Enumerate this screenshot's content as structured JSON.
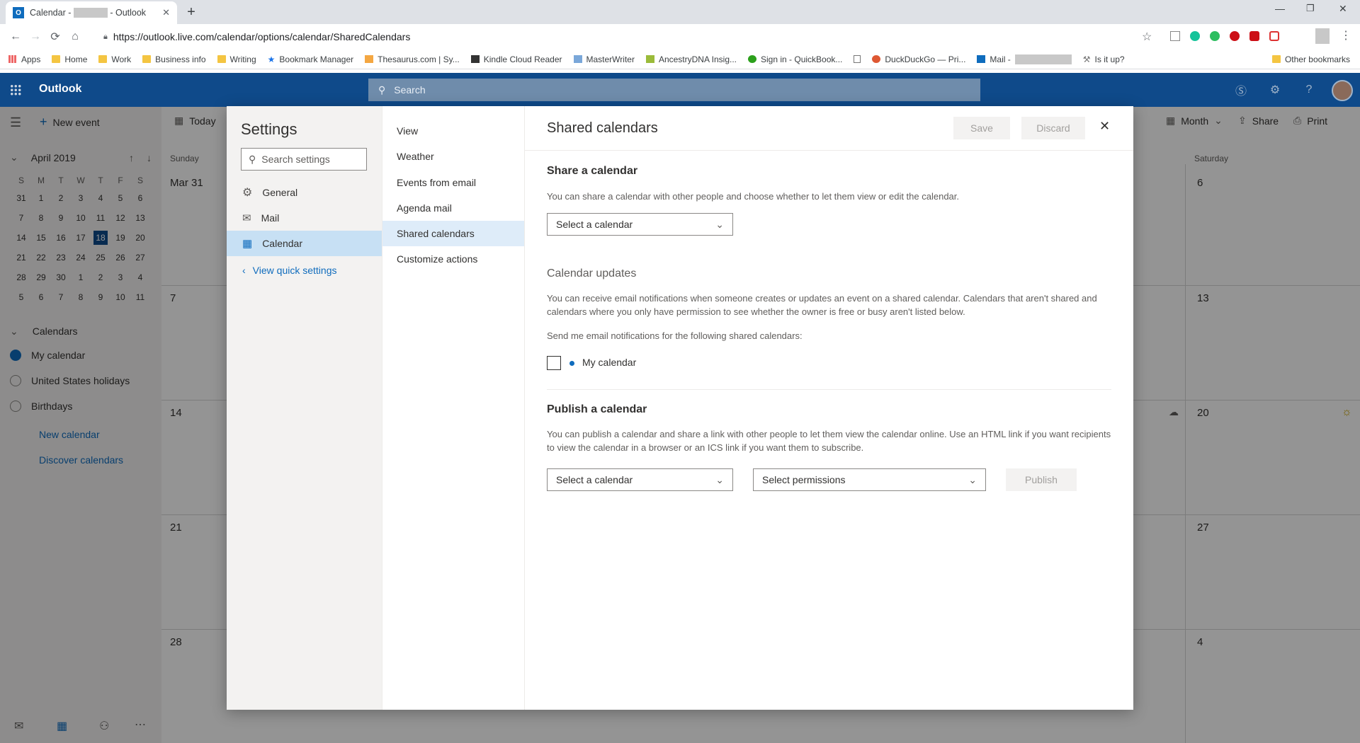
{
  "browser": {
    "tab_title_prefix": "Calendar -",
    "tab_title_suffix": "- Outlook",
    "url": "https://outlook.live.com/calendar/options/calendar/SharedCalendars",
    "bookmarks": [
      "Apps",
      "Home",
      "Work",
      "Business info",
      "Writing",
      "Bookmark Manager",
      "Thesaurus.com | Sy...",
      "Kindle Cloud Reader",
      "MasterWriter",
      "AncestryDNA Insig...",
      "Sign in - QuickBook...",
      "DuckDuckGo — Pri...",
      "Mail -",
      "Is it up?"
    ],
    "other_bookmarks": "Other bookmarks"
  },
  "header": {
    "brand": "Outlook",
    "search_placeholder": "Search"
  },
  "app": {
    "new_event": "New event",
    "today": "Today",
    "view_mode": "Month",
    "share": "Share",
    "print": "Print",
    "mini_cal_title": "April 2019",
    "weekday_letters": [
      "S",
      "M",
      "T",
      "W",
      "T",
      "F",
      "S"
    ],
    "weeks": [
      [
        "31",
        "1",
        "2",
        "3",
        "4",
        "5",
        "6"
      ],
      [
        "7",
        "8",
        "9",
        "10",
        "11",
        "12",
        "13"
      ],
      [
        "14",
        "15",
        "16",
        "17",
        "18",
        "19",
        "20"
      ],
      [
        "21",
        "22",
        "23",
        "24",
        "25",
        "26",
        "27"
      ],
      [
        "28",
        "29",
        "30",
        "1",
        "2",
        "3",
        "4"
      ],
      [
        "5",
        "6",
        "7",
        "8",
        "9",
        "10",
        "11"
      ]
    ],
    "today_date": "18",
    "calendars_heading": "Calendars",
    "calendars": [
      "My calendar",
      "United States holidays",
      "Birthdays"
    ],
    "new_calendar": "New calendar",
    "discover_calendars": "Discover calendars",
    "col_sunday": "Sunday",
    "col_saturday": "Saturday",
    "sunday_dates": [
      "Mar 31",
      "7",
      "14",
      "21",
      "28"
    ],
    "saturday_dates": [
      "6",
      "13",
      "20",
      "27",
      "4"
    ]
  },
  "settings": {
    "title": "Settings",
    "search_placeholder": "Search settings",
    "categories": [
      "General",
      "Mail",
      "Calendar"
    ],
    "active_category": "Calendar",
    "view_quick": "View quick settings",
    "subsections": [
      "View",
      "Weather",
      "Events from email",
      "Agenda mail",
      "Shared calendars",
      "Customize actions"
    ],
    "active_subsection": "Shared calendars"
  },
  "panel": {
    "title": "Shared calendars",
    "save": "Save",
    "discard": "Discard",
    "share_heading": "Share a calendar",
    "share_desc": "You can share a calendar with other people and choose whether to let them view or edit the calendar.",
    "select_calendar": "Select a calendar",
    "updates_heading": "Calendar updates",
    "updates_desc": "You can receive email notifications when someone creates or updates an event on a shared calendar. Calendars that aren't shared and calendars where you only have permission to see whether the owner is free or busy aren't listed below.",
    "send_me": "Send me email notifications for the following shared calendars:",
    "checkbox_label": "My calendar",
    "checkbox_checked": false,
    "publish_heading": "Publish a calendar",
    "publish_desc": "You can publish a calendar and share a link with other people to let them view the calendar online. Use an HTML link if you want recipients to view the calendar in a browser or an ICS link if you want them to subscribe.",
    "select_calendar_2": "Select a calendar",
    "select_permissions": "Select permissions",
    "publish": "Publish"
  },
  "colors": {
    "brand_blue": "#0f4a8a",
    "active_category_bg": "#c7e0f4",
    "active_sub_bg": "#deecf9"
  }
}
